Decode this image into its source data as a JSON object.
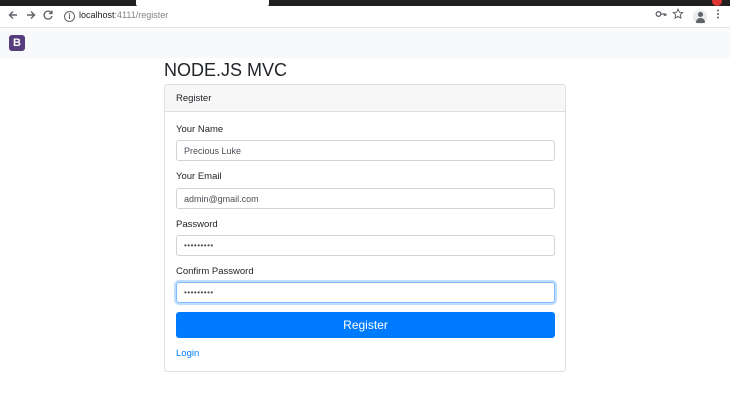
{
  "browser": {
    "url_host": "localhost",
    "url_path": ":4111/register"
  },
  "navbar": {
    "brand_letter": "B"
  },
  "page": {
    "title": "NODE.JS MVC"
  },
  "form": {
    "header": "Register",
    "name_label": "Your Name",
    "name_value": "Precious Luke",
    "email_label": "Your Email",
    "email_value": "admin@gmail.com",
    "password_label": "Password",
    "password_value": "•••••••••",
    "confirm_label": "Confirm Password",
    "confirm_value": "•••••••••",
    "submit_label": "Register",
    "login_link": "Login"
  },
  "colors": {
    "primary": "#007bff",
    "brand": "#563d7c",
    "focus_border": "#80bdff"
  }
}
